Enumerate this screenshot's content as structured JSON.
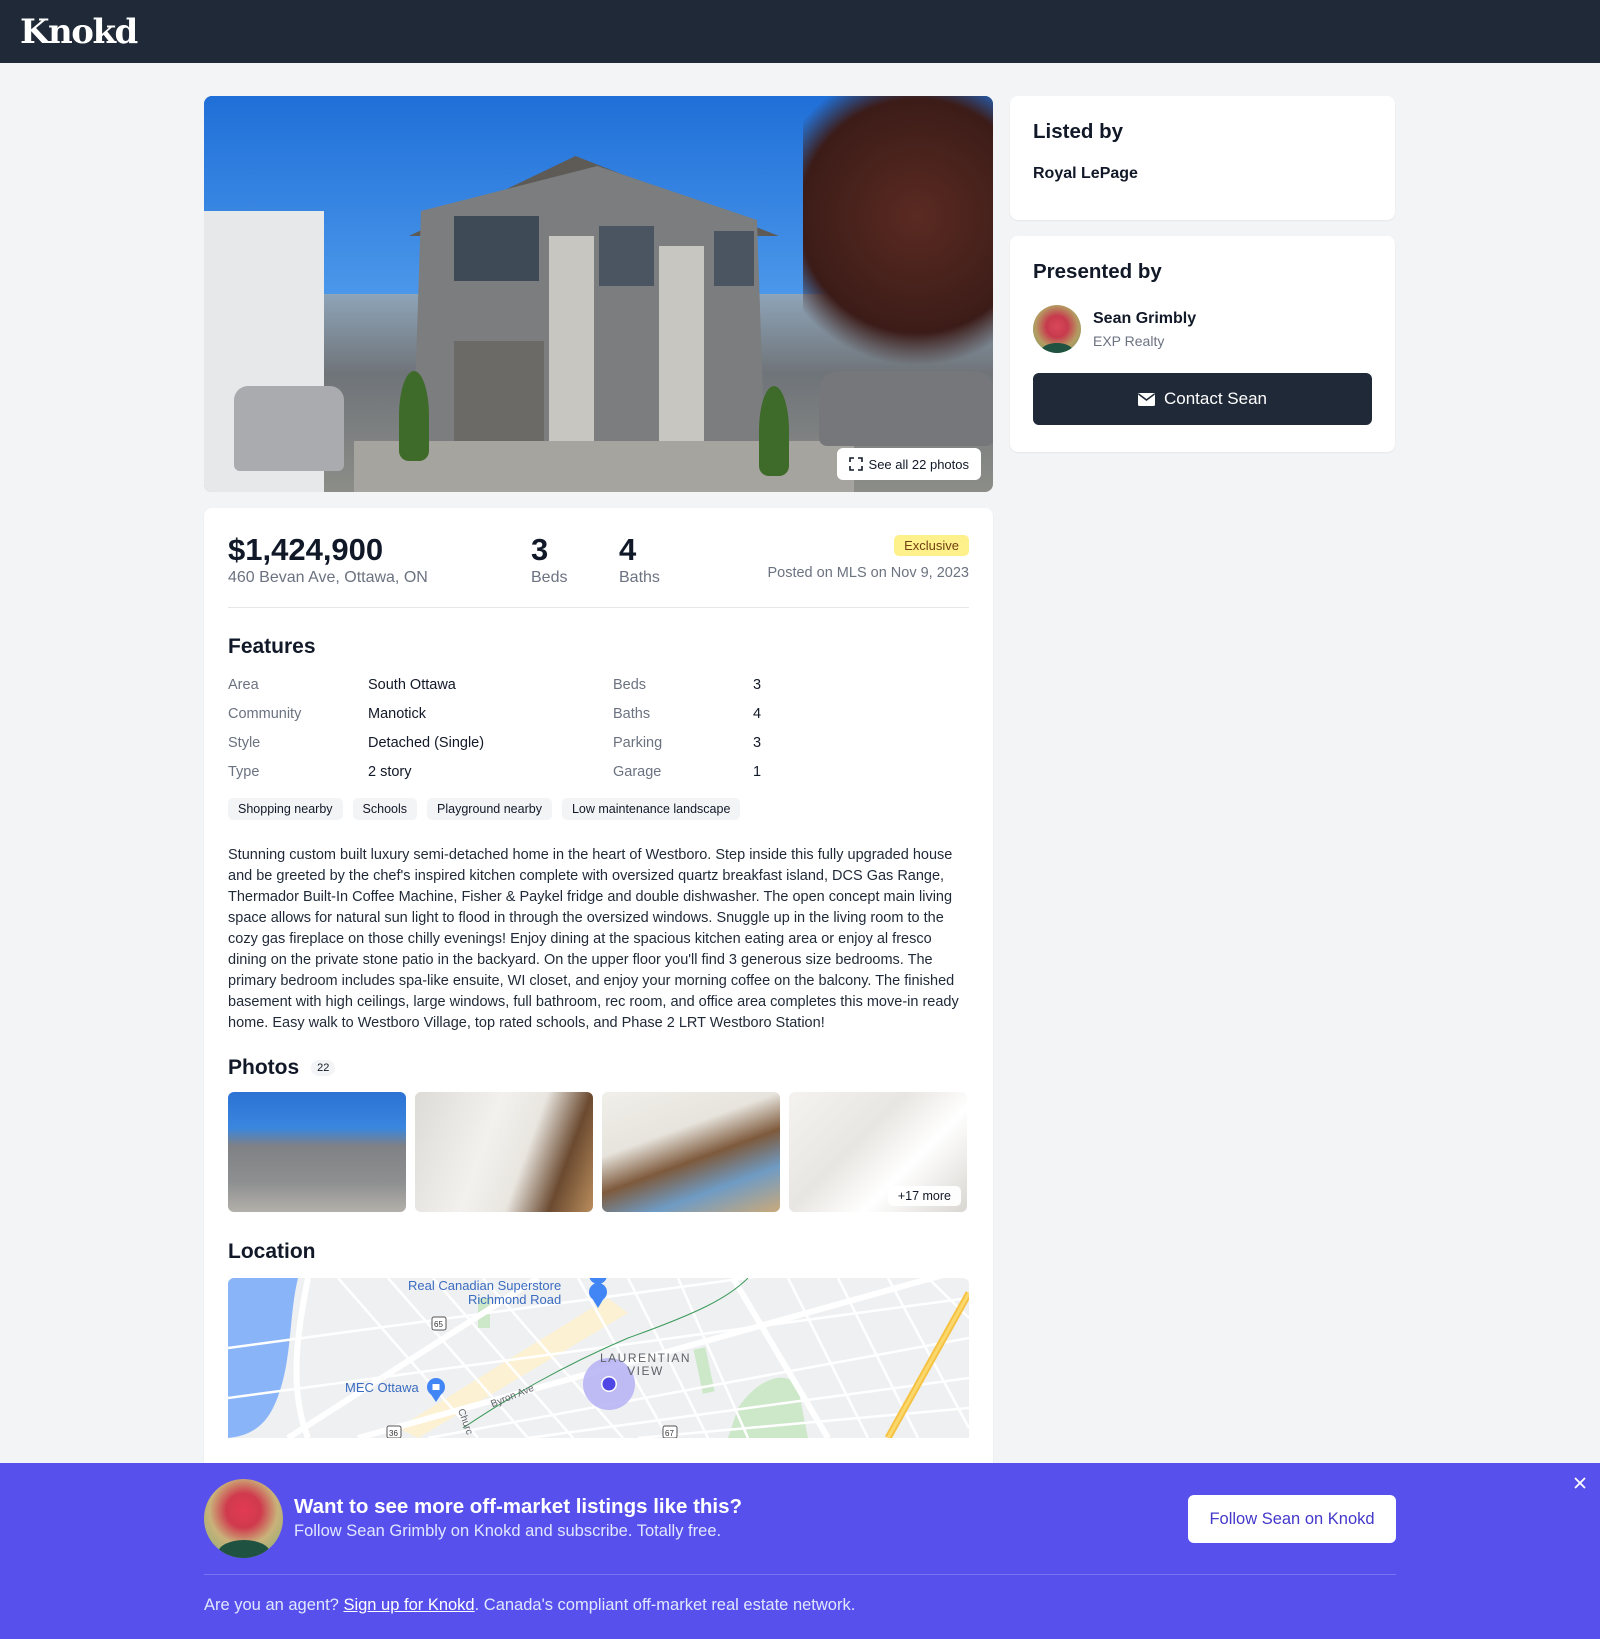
{
  "header": {
    "logo": "Knokd"
  },
  "hero": {
    "see_all_label": "See all 22 photos"
  },
  "listing": {
    "price": "$1,424,900",
    "address": "460 Bevan Ave, Ottawa, ON",
    "beds": {
      "value": "3",
      "label": "Beds"
    },
    "baths": {
      "value": "4",
      "label": "Baths"
    },
    "badge": "Exclusive",
    "posted": "Posted on MLS on Nov 9, 2023"
  },
  "features": {
    "title": "Features",
    "rows": [
      {
        "label": "Area",
        "value": "South Ottawa",
        "label2": "Beds",
        "value2": "3"
      },
      {
        "label": "Community",
        "value": "Manotick",
        "label2": "Baths",
        "value2": "4"
      },
      {
        "label": "Style",
        "value": "Detached (Single)",
        "label2": "Parking",
        "value2": "3"
      },
      {
        "label": "Type",
        "value": "2 story",
        "label2": "Garage",
        "value2": "1"
      }
    ],
    "tags": [
      "Shopping nearby",
      "Schools",
      "Playground nearby",
      "Low maintenance landscape"
    ]
  },
  "description": "Stunning custom built luxury semi-detached home in the heart of Westboro. Step inside this fully upgraded house and be greeted by the chef's inspired kitchen complete with oversized quartz breakfast island, DCS Gas Range, Thermador Built-In Coffee Machine, Fisher & Paykel fridge and double dishwasher. The open concept main living space allows for natural sun light to flood in through the oversized windows. Snuggle up in the living room to the cozy gas fireplace on those chilly evenings! Enjoy dining at the spacious kitchen eating area or enjoy al fresco dining on the private stone patio in the backyard. On the upper floor you'll find 3 generous size bedrooms. The primary bedroom includes spa-like ensuite, WI closet, and enjoy your morning coffee on the balcony. The finished basement with high ceilings, large windows, full bathroom, rec room, and office area completes this move-in ready home. Easy walk to Westboro Village, top rated schools, and Phase 2 LRT Westboro Station!",
  "photos": {
    "title": "Photos",
    "count": "22",
    "more_label": "+17 more"
  },
  "location": {
    "title": "Location",
    "map_labels": {
      "store": "Real Canadian Superstore\nRichmond Road",
      "store_line1": "Real Canadian Superstore",
      "store_line2": "Richmond Road",
      "mec": "MEC Ottawa",
      "area_line1": "LAURENTIAN",
      "area_line2": "VIEW",
      "street": "Byron Ave",
      "street2": "Churc",
      "route65": "65",
      "route67": "67",
      "route36": "36"
    }
  },
  "sidebar": {
    "listed_by": {
      "title": "Listed by",
      "name": "Royal LePage"
    },
    "presented_by": {
      "title": "Presented by",
      "agent_name": "Sean Grimbly",
      "agent_company": "EXP Realty",
      "contact_label": "Contact Sean"
    }
  },
  "banner": {
    "headline": "Want to see more off-market listings like this?",
    "subtext": "Follow Sean Grimbly on Knokd and subscribe. Totally free.",
    "follow_label": "Follow Sean on Knokd",
    "agent_prefix": "Are you an agent? ",
    "agent_link": "Sign up for Knokd",
    "agent_suffix": ". Canada's compliant off-market real estate network."
  },
  "colors": {
    "header_bg": "#1f2937",
    "banner_bg": "#5850ec",
    "badge_bg": "#fef08a",
    "map_pin": "#4f46e5"
  }
}
